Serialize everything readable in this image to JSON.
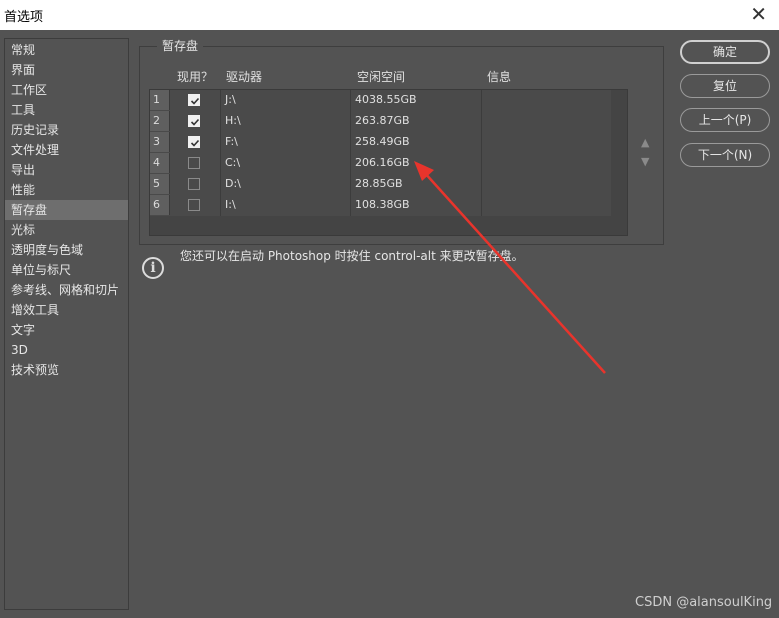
{
  "window": {
    "title": "首选项",
    "close_glyph": "✕"
  },
  "sidebar": {
    "items": [
      {
        "label": "常规"
      },
      {
        "label": "界面"
      },
      {
        "label": "工作区"
      },
      {
        "label": "工具"
      },
      {
        "label": "历史记录"
      },
      {
        "label": "文件处理"
      },
      {
        "label": "导出"
      },
      {
        "label": "性能"
      },
      {
        "label": "暂存盘",
        "selected": true
      },
      {
        "label": "光标"
      },
      {
        "label": "透明度与色域"
      },
      {
        "label": "单位与标尺"
      },
      {
        "label": "参考线、网格和切片"
      },
      {
        "label": "增效工具"
      },
      {
        "label": "文字"
      },
      {
        "label": "3D"
      },
      {
        "label": "技术预览"
      }
    ]
  },
  "scratch": {
    "group_title": "暂存盘",
    "columns": {
      "active": "现用？",
      "drive": "驱动器",
      "free": "空闲空间",
      "info": "信息"
    },
    "rows": [
      {
        "num": "1",
        "checked": true,
        "drive": "J:\\",
        "free": "4038.55GB",
        "info": ""
      },
      {
        "num": "2",
        "checked": true,
        "drive": "H:\\",
        "free": "263.87GB",
        "info": ""
      },
      {
        "num": "3",
        "checked": true,
        "drive": "F:\\",
        "free": "258.49GB",
        "info": ""
      },
      {
        "num": "4",
        "checked": false,
        "drive": "C:\\",
        "free": "206.16GB",
        "info": ""
      },
      {
        "num": "5",
        "checked": false,
        "drive": "D:\\",
        "free": "28.85GB",
        "info": ""
      },
      {
        "num": "6",
        "checked": false,
        "drive": "I:\\",
        "free": "108.38GB",
        "info": ""
      }
    ],
    "move_up": "▲",
    "move_down": "▼"
  },
  "buttons": {
    "ok": "确定",
    "reset": "复位",
    "prev": "上一个(P)",
    "next": "下一个(N)"
  },
  "info": {
    "icon": "info-icon",
    "glyph": "i",
    "text": "您还可以在启动 Photoshop 时按住 control-alt 来更改暂存盘。"
  },
  "watermark": "CSDN @alansoulKing",
  "colors": {
    "background": "#535353",
    "selected": "#6e6e6e",
    "annotation_arrow": "#e8342c"
  }
}
